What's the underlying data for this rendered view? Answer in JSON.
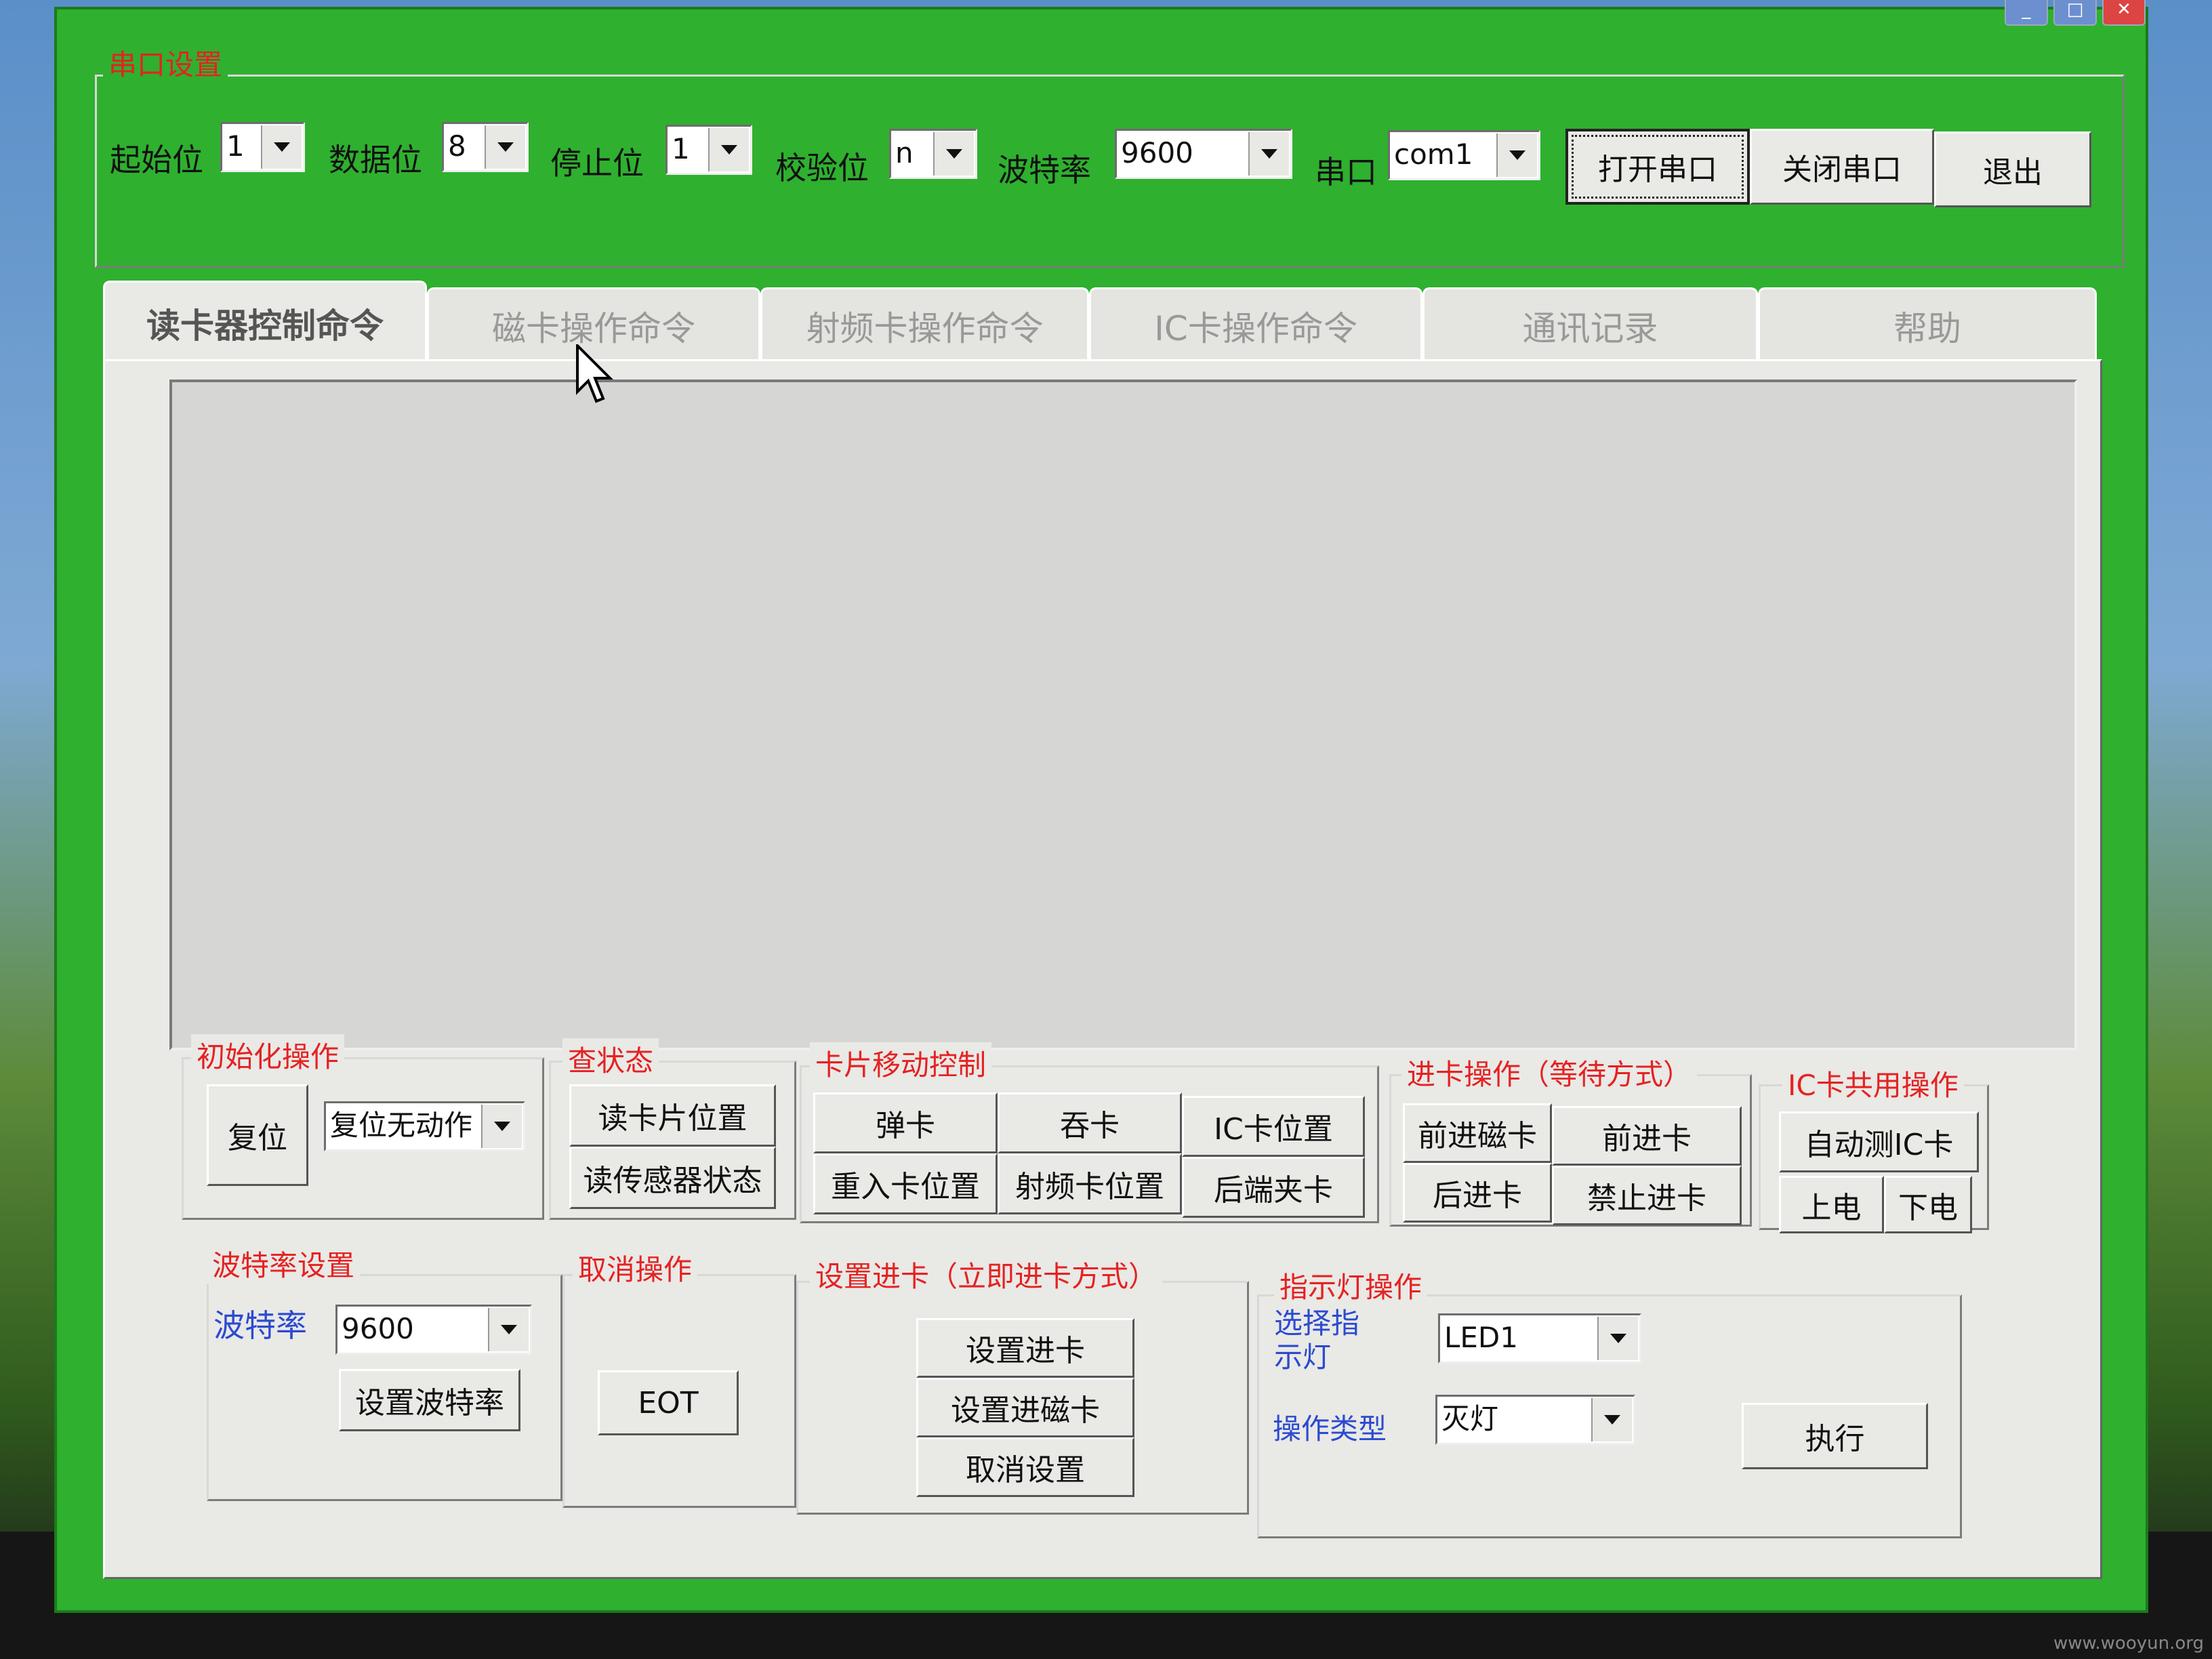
{
  "serial": {
    "legend": "串口设置",
    "start_bit": {
      "label": "起始位",
      "value": "1"
    },
    "data_bit": {
      "label": "数据位",
      "value": "8"
    },
    "stop_bit": {
      "label": "停止位",
      "value": "1"
    },
    "parity": {
      "label": "校验位",
      "value": "n"
    },
    "baud": {
      "label": "波特率",
      "value": "9600"
    },
    "port": {
      "label": "串口",
      "value": "com1"
    },
    "open_btn": "打开串口",
    "close_btn": "关闭串口",
    "exit_btn": "退出"
  },
  "tabs": [
    "读卡器控制命令",
    "磁卡操作命令",
    "射频卡操作命令",
    "IC卡操作命令",
    "通讯记录",
    "帮助"
  ],
  "init": {
    "legend": "初始化操作",
    "reset_btn": "复位",
    "reset_mode": "复位无动作"
  },
  "status": {
    "legend": "查状态",
    "read_pos_btn": "读卡片位置",
    "read_sensor_btn": "读传感器状态"
  },
  "move": {
    "legend": "卡片移动控制",
    "buttons": [
      "弹卡",
      "吞卡",
      "IC卡位置",
      "重入卡位置",
      "射频卡位置",
      "后端夹卡"
    ]
  },
  "insert": {
    "legend": "进卡操作（等待方式）",
    "buttons": [
      "前进磁卡",
      "前进卡",
      "后进卡",
      "禁止进卡"
    ]
  },
  "ic_common": {
    "legend": "IC卡共用操作",
    "auto_btn": "自动测IC卡",
    "power_on": "上电",
    "power_off": "下电"
  },
  "baud_set": {
    "legend": "波特率设置",
    "label": "波特率",
    "value": "9600",
    "set_btn": "设置波特率"
  },
  "cancel": {
    "legend": "取消操作",
    "eot_btn": "EOT"
  },
  "set_insert": {
    "legend": "设置进卡（立即进卡方式）",
    "set_btn": "设置进卡",
    "set_mag_btn": "设置进磁卡",
    "cancel_btn": "取消设置"
  },
  "led": {
    "legend": "指示灯操作",
    "select_label": "选择指示灯",
    "select_value": "LED1",
    "type_label": "操作类型",
    "type_value": "灭灯",
    "exec_btn": "执行"
  },
  "watermark": "www.wooyun.org"
}
